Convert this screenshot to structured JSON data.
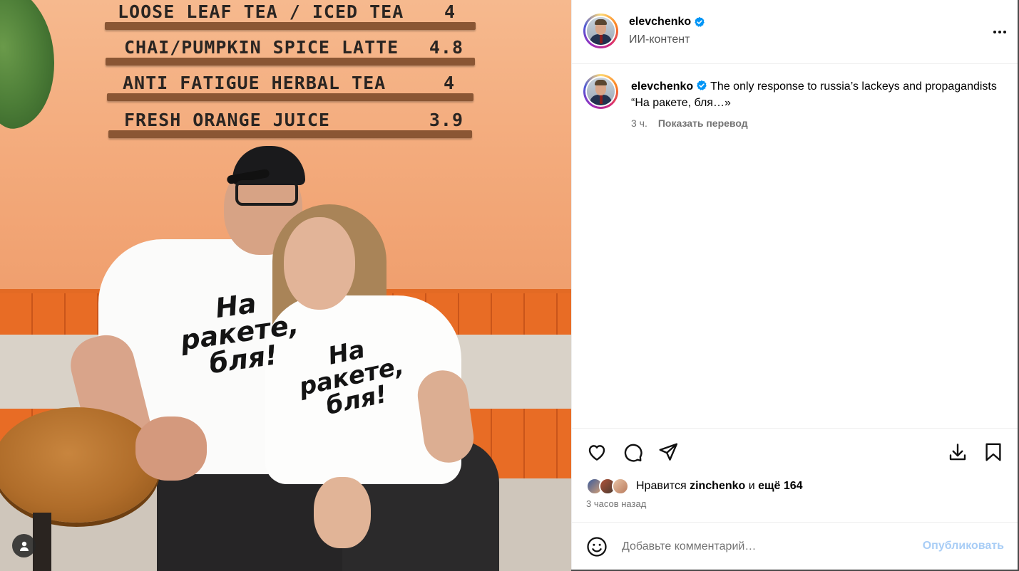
{
  "photo": {
    "menu_board": [
      {
        "item": "LOOSE LEAF TEA / ICED TEA",
        "price": "4"
      },
      {
        "item": "CHAI/PUMPKIN SPICE LATTE",
        "price": "4.8"
      },
      {
        "item": "ANTI FATIGUE HERBAL TEA",
        "price": "4"
      },
      {
        "item": "FRESH ORANGE JUICE",
        "price": "3.9"
      }
    ],
    "shirt_print_man": [
      "На ракете,",
      "бля!"
    ],
    "shirt_print_woman": [
      "На ракете,",
      "бля!"
    ],
    "user_tag_icon": "person-icon"
  },
  "post": {
    "username": "elevchenko",
    "verified": true,
    "subtitle": "ИИ-контент",
    "more_icon": "more-horizontal-icon",
    "caption": {
      "username": "elevchenko",
      "text": "The only response to russia’s lackeys and propagandists “На ракете, бля…»",
      "time": "3 ч.",
      "translate_label": "Показать перевод"
    },
    "actions": {
      "like_icon": "heart-icon",
      "comment_icon": "comment-icon",
      "share_icon": "send-icon",
      "download_icon": "download-icon",
      "save_icon": "bookmark-icon"
    },
    "likes": {
      "prefix": "Нравится",
      "user": "zinchenko",
      "joiner": "и",
      "others": "ещё 164"
    },
    "time_ago": "3 часов назад",
    "comment": {
      "placeholder": "Добавьте комментарий…",
      "publish_label": "Опубликовать",
      "emoji_icon": "emoji-icon"
    }
  },
  "colors": {
    "verified_blue": "#0095f6",
    "publish_disabled": "#a8cdf6",
    "muted_text": "#737373"
  }
}
